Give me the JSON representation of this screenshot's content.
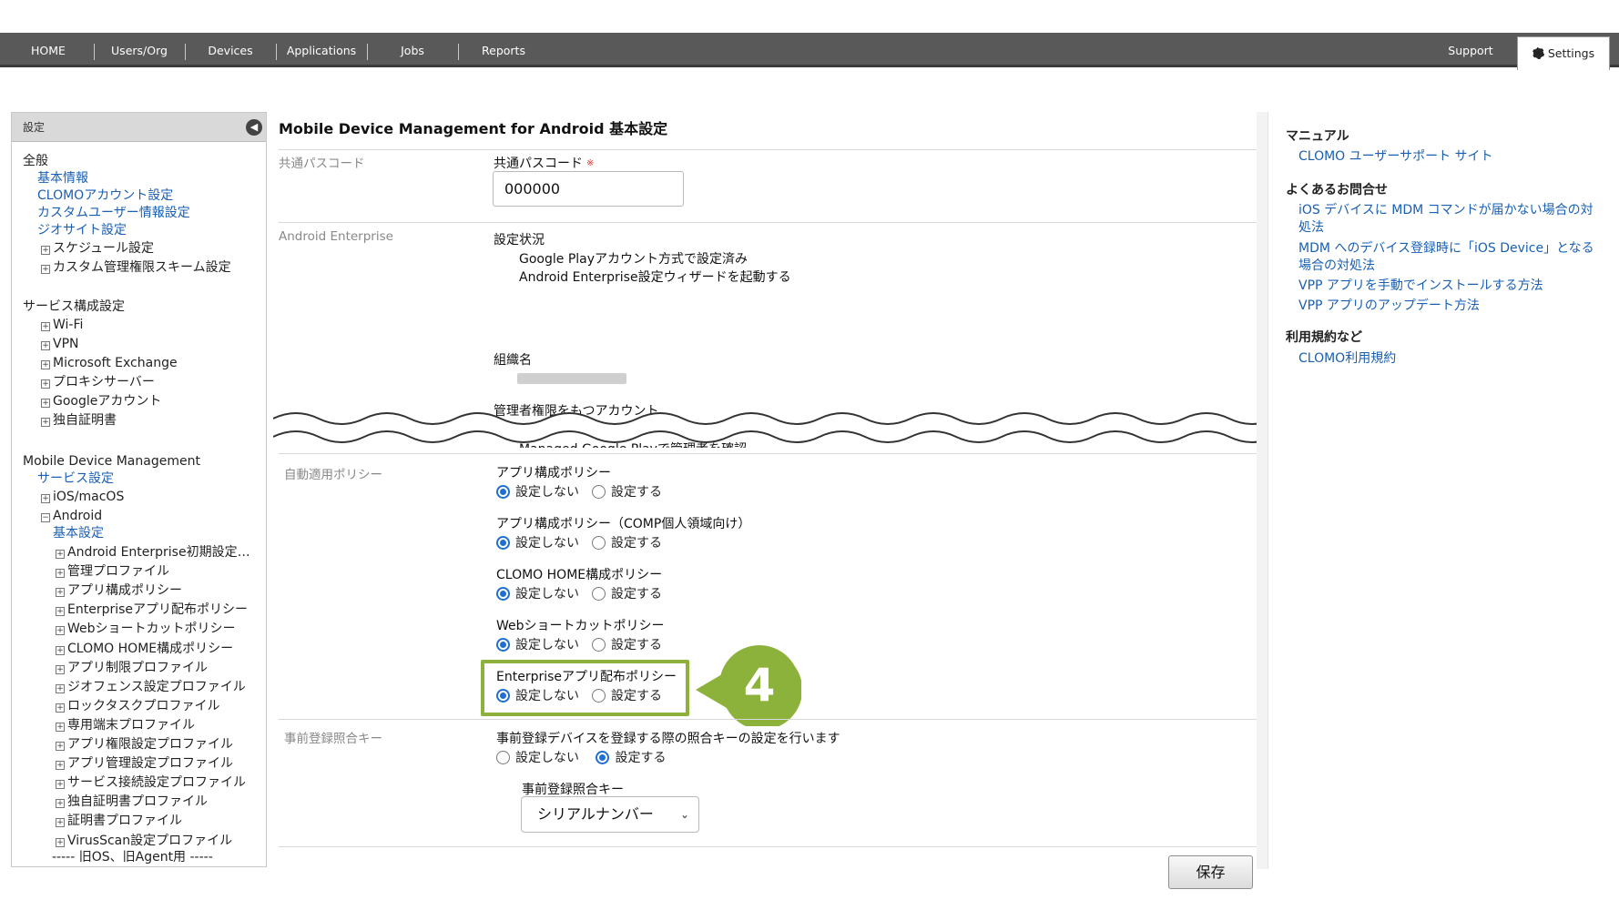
{
  "nav": {
    "items": [
      "HOME",
      "Users/Org",
      "Devices",
      "Applications",
      "Jobs",
      "Reports"
    ],
    "support": "Support",
    "settings": "Settings"
  },
  "sidebar": {
    "header": "設定",
    "general": {
      "title": "全般",
      "links": [
        "基本情報",
        "CLOMOアカウント設定",
        "カスタムユーザー情報設定",
        "ジオサイト設定"
      ],
      "expandables": [
        "スケジュール設定",
        "カスタム管理権限スキーム設定"
      ]
    },
    "service": {
      "title": "サービス構成設定",
      "items": [
        "Wi-Fi",
        "VPN",
        "Microsoft Exchange",
        "プロキシサーバー",
        "Googleアカウント",
        "独自証明書"
      ]
    },
    "mdm": {
      "title": "Mobile Device Management",
      "service_settings": "サービス設定",
      "ios": "iOS/macOS",
      "android": "Android",
      "android_basic": "基本設定",
      "android_items": [
        "Android Enterprise初期設定…",
        "管理プロファイル",
        "アプリ構成ポリシー",
        "Enterpriseアプリ配布ポリシー",
        "Webショートカットポリシー",
        "CLOMO HOME構成ポリシー",
        "アプリ制限プロファイル",
        "ジオフェンス設定プロファイル",
        "ロックタスクプロファイル",
        "専用端末プロファイル",
        "アプリ権限設定プロファイル",
        "アプリ管理設定プロファイル",
        "サービス接続設定プロファイル",
        "独自証明書プロファイル",
        "証明書プロファイル",
        "VirusScan設定プロファイル"
      ],
      "legacy": "----- 旧OS、旧Agent用 -----"
    }
  },
  "main": {
    "title": "Mobile Device Management for Android 基本設定",
    "passcode": {
      "section": "共通パスコード",
      "label": "共通パスコード",
      "required_mark": "※",
      "value": "000000"
    },
    "enterprise": {
      "section": "Android Enterprise",
      "status_label": "設定状況",
      "status_value": "Google Playアカウント方式で設定済み",
      "wizard_link": "Android Enterprise設定ウィザードを起動する",
      "org_label": "組織名",
      "admin_label": "管理者権限をもつアカウント",
      "managed_link": "Managed Google Playで管理者を確認"
    },
    "auto_policy": {
      "section": "自動適用ポリシー",
      "off_label": "設定しない",
      "on_label": "設定する",
      "policies": [
        {
          "label": "アプリ構成ポリシー",
          "selected": "off"
        },
        {
          "label": "アプリ構成ポリシー（COMP個人領域向け）",
          "selected": "off"
        },
        {
          "label": "CLOMO HOME構成ポリシー",
          "selected": "off"
        },
        {
          "label": "Webショートカットポリシー",
          "selected": "off"
        },
        {
          "label": "Enterpriseアプリ配布ポリシー",
          "selected": "off"
        }
      ]
    },
    "prereg": {
      "section": "事前登録照合キー",
      "description": "事前登録デバイスを登録する際の照合キーの設定を行います",
      "off_label": "設定しない",
      "on_label": "設定する",
      "selected": "on",
      "key_label": "事前登録照合キー",
      "key_value": "シリアルナンバー"
    },
    "save": "保存",
    "step_number": "4",
    "highlight_color": "#8db23b"
  },
  "right": {
    "manual_title": "マニュアル",
    "manual_links": [
      "CLOMO ユーザーサポート サイト"
    ],
    "faq_title": "よくあるお問合せ",
    "faq_links": [
      "iOS デバイスに MDM コマンドが届かない場合の対処法",
      "MDM へのデバイス登録時に「iOS Device」となる場合の対処法",
      "VPP アプリを手動でインストールする方法",
      "VPP アプリのアップデート方法"
    ],
    "terms_title": "利用規約など",
    "terms_links": [
      "CLOMO利用規約"
    ]
  },
  "colors": {
    "nav_bg": "#595959",
    "link": "#1a5fb4",
    "radio_on": "#1f6fd1",
    "badge": "#8db23b"
  }
}
